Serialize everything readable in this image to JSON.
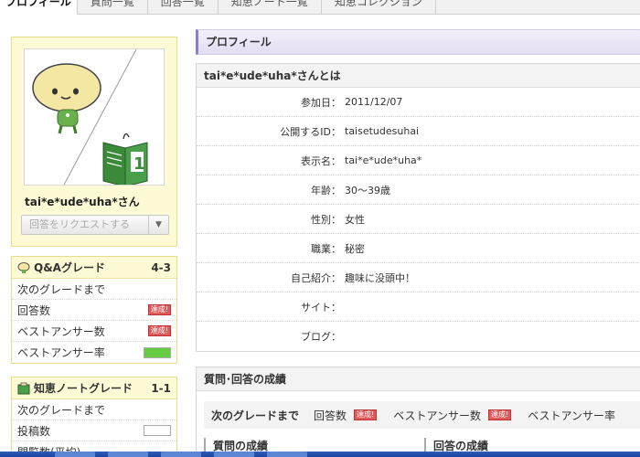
{
  "tabs": [
    {
      "label": "プロフィール",
      "active": true
    },
    {
      "label": "質問一覧",
      "active": false
    },
    {
      "label": "回答一覧",
      "active": false
    },
    {
      "label": "知恵ノート一覧",
      "active": false
    },
    {
      "label": "知恵コレクション",
      "active": false
    }
  ],
  "profile": {
    "nickname": "tai*e*ude*uha*さん",
    "request_button": "回答をリクエストする"
  },
  "qa_grade": {
    "title": "Q&Aグレード",
    "level": "4-3",
    "rows": [
      {
        "label": "次のグレードまで"
      },
      {
        "label": "回答数",
        "badge": "達成!"
      },
      {
        "label": "ベストアンサー数",
        "badge": "達成!"
      },
      {
        "label": "ベストアンサー率",
        "progress": 1.0
      }
    ]
  },
  "note_grade": {
    "title": "知恵ノートグレード",
    "level": "1-1",
    "rows": [
      {
        "label": "次のグレードまで"
      },
      {
        "label": "投稿数",
        "progress": 0
      },
      {
        "label": "閲覧数(平均)"
      }
    ]
  },
  "section_title": "プロフィール",
  "info": {
    "heading": "tai*e*ude*uha*さんとは",
    "rows": [
      {
        "key": "参加日：",
        "value": "2011/12/07"
      },
      {
        "key": "公開するID：",
        "value": "taisetudesuhai"
      },
      {
        "key": "表示名：",
        "value": "tai*e*ude*uha*"
      },
      {
        "key": "年齢：",
        "value": "30〜39歳"
      },
      {
        "key": "性別：",
        "value": "女性"
      },
      {
        "key": "職業：",
        "value": "秘密"
      },
      {
        "key": "自己紹介：",
        "value": "趣味に没頭中！"
      },
      {
        "key": "サイト：",
        "value": ""
      },
      {
        "key": "ブログ：",
        "value": ""
      }
    ]
  },
  "stats": {
    "heading": "質問･回答の成績",
    "next_label": "次のグレードまで",
    "answers_label": "回答数",
    "answers_badge": "達成!",
    "best_label": "ベストアンサー数",
    "best_badge": "達成!",
    "rate_label": "ベストアンサー率",
    "question_stats": "質問の成績",
    "answer_stats": "回答の成績"
  },
  "colors": {
    "accent": "#8c7fc0",
    "grade_bg": "#fffad6",
    "badge": "#e05a5a",
    "progress": "#66cc44"
  }
}
